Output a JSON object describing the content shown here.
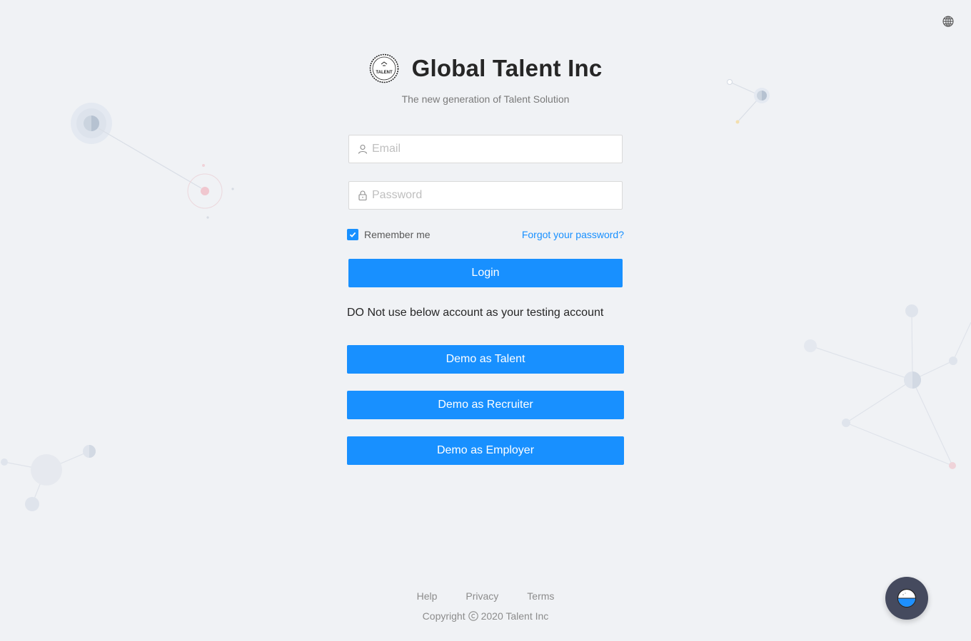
{
  "header": {
    "title": "Global Talent Inc",
    "subtitle": "The new generation of Talent Solution",
    "logo_icon": "talent-seal-logo",
    "logo_text": "TALENT"
  },
  "language_icon": "globe-icon",
  "form": {
    "email": {
      "value": "",
      "placeholder": "Email",
      "icon": "user-icon"
    },
    "password": {
      "value": "",
      "placeholder": "Password",
      "icon": "lock-icon"
    },
    "remember_label": "Remember me",
    "remember_checked": true,
    "forgot_label": "Forgot your password?",
    "login_label": "Login"
  },
  "demo": {
    "warning": "DO Not use below account as your testing account",
    "talent_label": "Demo as Talent",
    "recruiter_label": "Demo as Recruiter",
    "employer_label": "Demo as Employer"
  },
  "footer": {
    "help": "Help",
    "privacy": "Privacy",
    "terms": "Terms",
    "copyright_prefix": "Copyright",
    "copyright_suffix": "2020 Talent Inc"
  },
  "chat_icon": "chat-widget-icon",
  "colors": {
    "primary": "#1890ff",
    "background": "#f0f2f5",
    "chat_bg": "#454a5e"
  }
}
